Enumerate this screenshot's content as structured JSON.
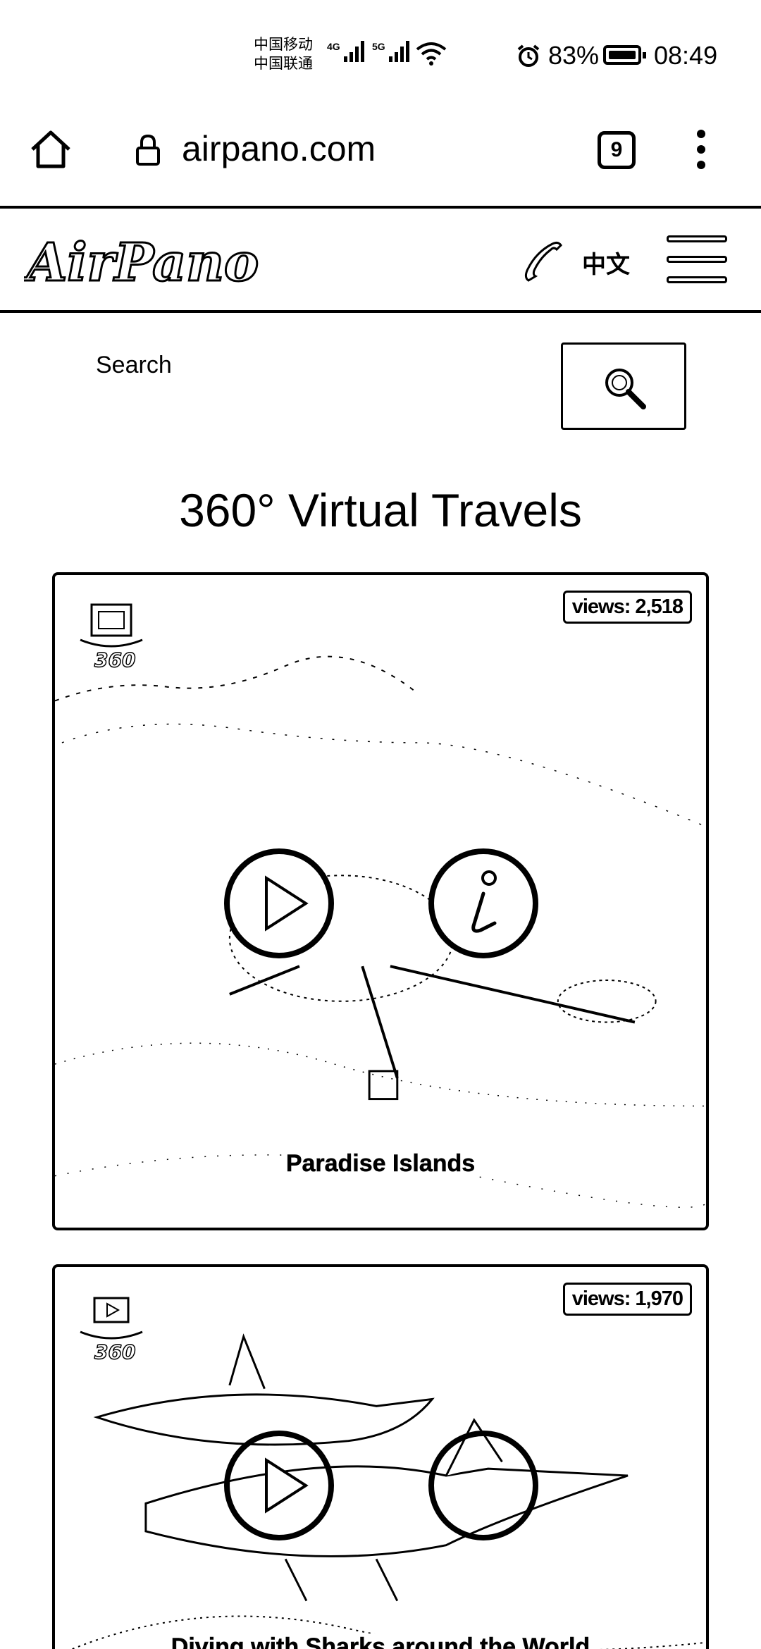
{
  "status_bar": {
    "carrier_1": "中国移动",
    "carrier_2": "中国联通",
    "network_1": "4G",
    "network_2": "5G",
    "battery": "83%",
    "time": "08:49"
  },
  "browser": {
    "url": "airpano.com",
    "tab_count": "9"
  },
  "header": {
    "logo_text": "AirPano",
    "language": "中文"
  },
  "search": {
    "placeholder": "Search"
  },
  "page": {
    "title": "360° Virtual Travels"
  },
  "tours": [
    {
      "title": "Paradise Islands",
      "views": "views: 2,518",
      "type_icon": "panorama-360-icon",
      "has_info_button": true
    },
    {
      "title": "Diving with Sharks around the World",
      "views": "views: 1,970",
      "type_icon": "video-360-icon",
      "has_info_button": true
    }
  ],
  "colors": {
    "foreground": "#000000",
    "background": "#ffffff"
  }
}
